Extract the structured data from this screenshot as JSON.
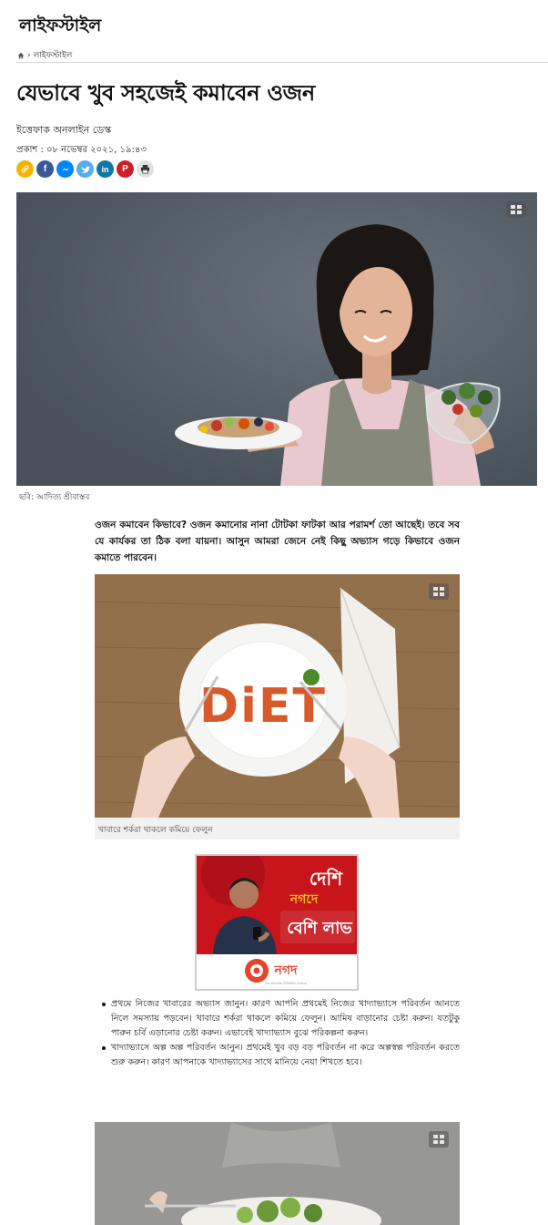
{
  "section": {
    "title": "লাইফস্টাইল"
  },
  "breadcrumb": {
    "home_icon": "home-icon",
    "separator": "›",
    "current": "লাইফস্টাইল"
  },
  "article": {
    "headline": "যেভাবে খুব সহজেই কমাবেন ওজন",
    "author": "ইত্তেফাক অনলাইন ডেস্ক",
    "published": "প্রকাশ : ০৮ নভেম্বর ২০২১, ১৯:৪৩",
    "hero_caption": "ছবি: আদিত্য শ্রীবাস্তব",
    "lead": "ওজন কমাবেন কিভাবে? ওজন কমানোর নানা টোটকা ফাটকা আর পরামর্শ তো আছেই। তবে সব যে কার্যকর তা ঠিক বলা যায়না। আসুন আমরা জেনে নেই কিছু অভ্যাস গড়ে কিভাবে ওজন কমাতে পারবেন।",
    "image2_text": "DiET",
    "image2_caption": "খাবারে শর্করা থাকলে কমিয়ে ফেলুন",
    "bullets": [
      "প্রথমে নিজের খাবারের অভ্যাস জানুন। কারণ আপনি প্রথমেই নিজের খাদ্যাভ্যাসে পরিবর্তন আনতে নিলে সমস্যায় পড়বেন। খাবারে শর্করা থাকলে কমিয়ে ফেলুন। আমিষ বাড়ানোর চেষ্টা করুন। যতটুকু পারুন চর্বি এড়ানোর চেষ্টা করুন। এভাবেই খাদ্যাভ্যাস বুঝে পরিকল্পনা করুন।",
      "খাদ্যাভ্যাসে অল্প অল্প পরিবর্তন আনুন। প্রথমেই খুব বড় বড় পরিবর্তন না করে অল্পস্বল্প পরিবর্তন করতে শুরু করুন। কারণ আপনাকে খাদ্যাভ্যাসের সাথে মানিয়ে নেয়া শিখতে হবে।"
    ]
  },
  "share": {
    "icons": [
      "link-icon",
      "facebook-icon",
      "messenger-icon",
      "twitter-icon",
      "linkedin-icon",
      "pinterest-icon",
      "print-icon"
    ],
    "colors": {
      "link": "#f4b400",
      "facebook": "#3b5998",
      "messenger": "#0084ff",
      "twitter": "#55acee",
      "linkedin": "#0e76a8",
      "pinterest": "#cb2027",
      "print": "#e2e2e2"
    }
  },
  "ad": {
    "headline_top": "দেশি",
    "headline_mid": "নগদে",
    "headline_bottom": "বেশি লাভ",
    "brand": "নগদ",
    "tagline": "ডাক বিভাগের ডিজিটাল লেনদেন",
    "colors": {
      "red": "#c8141b",
      "accent": "#f5c518"
    }
  },
  "gallery_icon": "gallery-icon"
}
